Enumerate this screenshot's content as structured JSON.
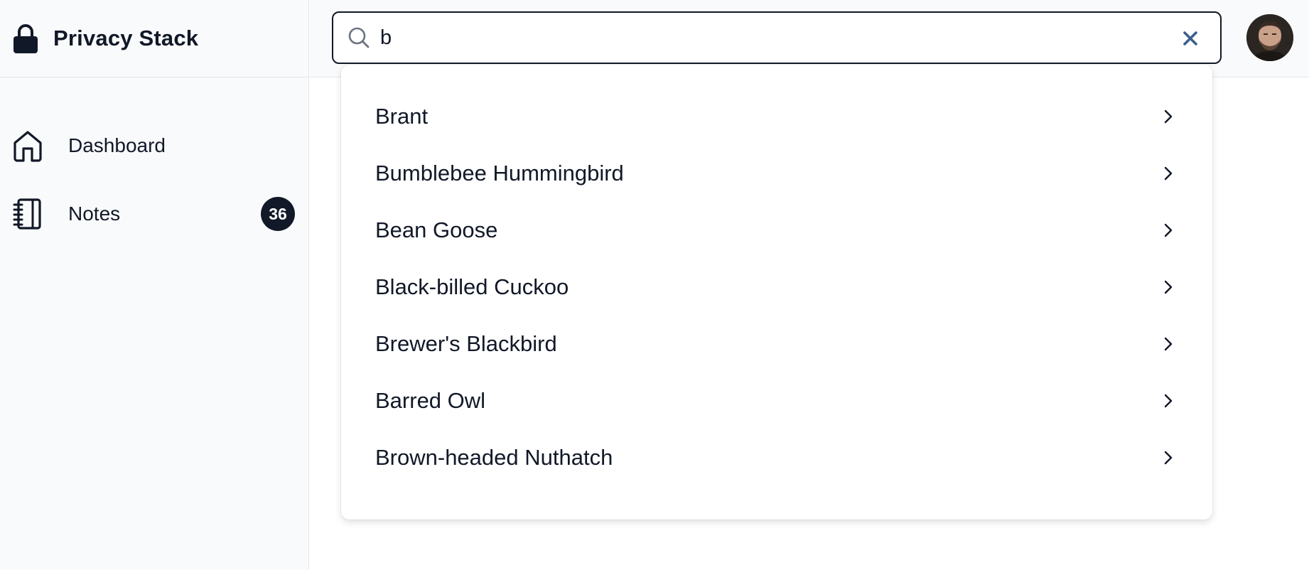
{
  "app": {
    "title": "Privacy Stack"
  },
  "sidebar": {
    "items": [
      {
        "label": "Dashboard",
        "icon": "home-icon"
      },
      {
        "label": "Notes",
        "icon": "notebook-icon",
        "badge": "36"
      }
    ]
  },
  "search": {
    "value": "b",
    "placeholder": "",
    "results": [
      "Brant",
      "Bumblebee Hummingbird",
      "Bean Goose",
      "Black-billed Cuckoo",
      "Brewer's Blackbird",
      "Barred Owl",
      "Brown-headed Nuthatch"
    ]
  },
  "colors": {
    "primary_text": "#111827",
    "sidebar_bg": "#f9fafb",
    "border": "#e5e7eb",
    "clear_icon": "#3b5e8c"
  }
}
